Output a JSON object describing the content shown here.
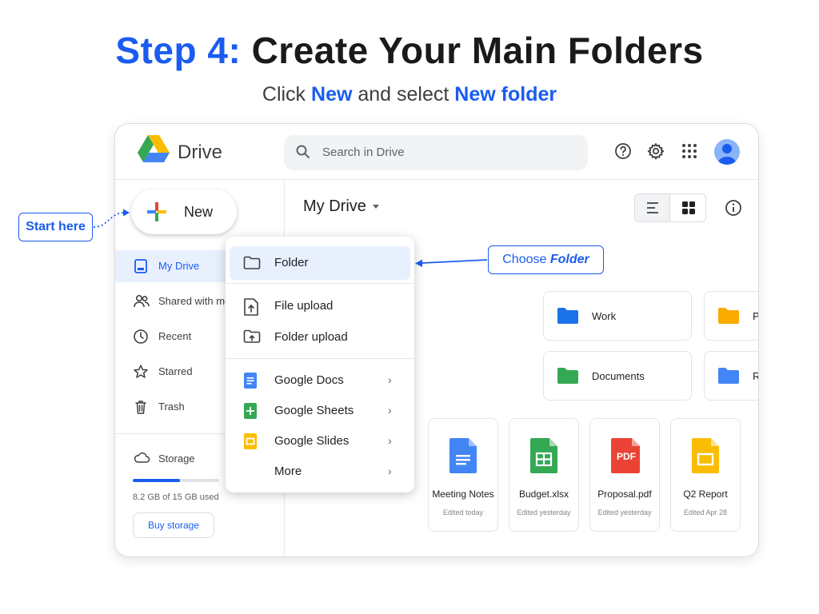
{
  "heading": {
    "step": "Step 4:",
    "title": "Create Your Main Folders"
  },
  "subheading": {
    "pre": "Click",
    "new": "New",
    "mid": "and select",
    "target": "New folder"
  },
  "app": {
    "name": "Drive"
  },
  "search": {
    "placeholder": "Search in Drive"
  },
  "topbar": {
    "icons": [
      "help-icon",
      "settings-icon",
      "apps-icon",
      "account-icon"
    ]
  },
  "sidebar": {
    "new_label": "New",
    "items": [
      {
        "label": "My Drive",
        "icon": "my-drive-icon",
        "active": true
      },
      {
        "label": "Shared with me",
        "icon": "shared-icon"
      },
      {
        "label": "Recent",
        "icon": "clock-icon"
      },
      {
        "label": "Starred",
        "icon": "star-icon"
      },
      {
        "label": "Trash",
        "icon": "trash-icon"
      }
    ],
    "storage": {
      "label": "Storage",
      "used": "8.2 GB of 15 GB used",
      "fraction": 0.55,
      "buy_label": "Buy storage"
    }
  },
  "main": {
    "title": "My Drive",
    "folders": [
      {
        "name": "Work",
        "color": "#1a73e8"
      },
      {
        "name": "Personal",
        "color": "#f9ab00"
      },
      {
        "name": "Documents",
        "color": "#34a853"
      },
      {
        "name": "Resources",
        "color": "#4285f4"
      }
    ],
    "files": [
      {
        "name": "Meeting Notes",
        "meta": "Edited today",
        "type": "doc"
      },
      {
        "name": "Budget.xlsx",
        "meta": "Edited yesterday",
        "type": "sheet"
      },
      {
        "name": "Proposal.pdf",
        "meta": "Edited yesterday",
        "type": "pdf",
        "badge": "PDF"
      },
      {
        "name": "Q2 Report",
        "meta": "Edited Apr 28",
        "type": "slides"
      }
    ]
  },
  "menu": {
    "items": [
      {
        "label": "Folder",
        "highlighted": true
      },
      {
        "label": "File upload"
      },
      {
        "label": "Folder upload"
      },
      {
        "label": "Google Docs",
        "submenu": true
      },
      {
        "label": "Google Sheets",
        "submenu": true
      },
      {
        "label": "Google Slides",
        "submenu": true
      },
      {
        "label": "More",
        "submenu": true
      }
    ]
  },
  "callouts": {
    "start": "Start here",
    "choose_pre": "Choose",
    "choose_target": "Folder"
  },
  "colors": {
    "accent": "#1a5cf0",
    "blue": "#4285f4",
    "green": "#34a853",
    "yellow": "#fbbc04",
    "red": "#ea4335"
  }
}
